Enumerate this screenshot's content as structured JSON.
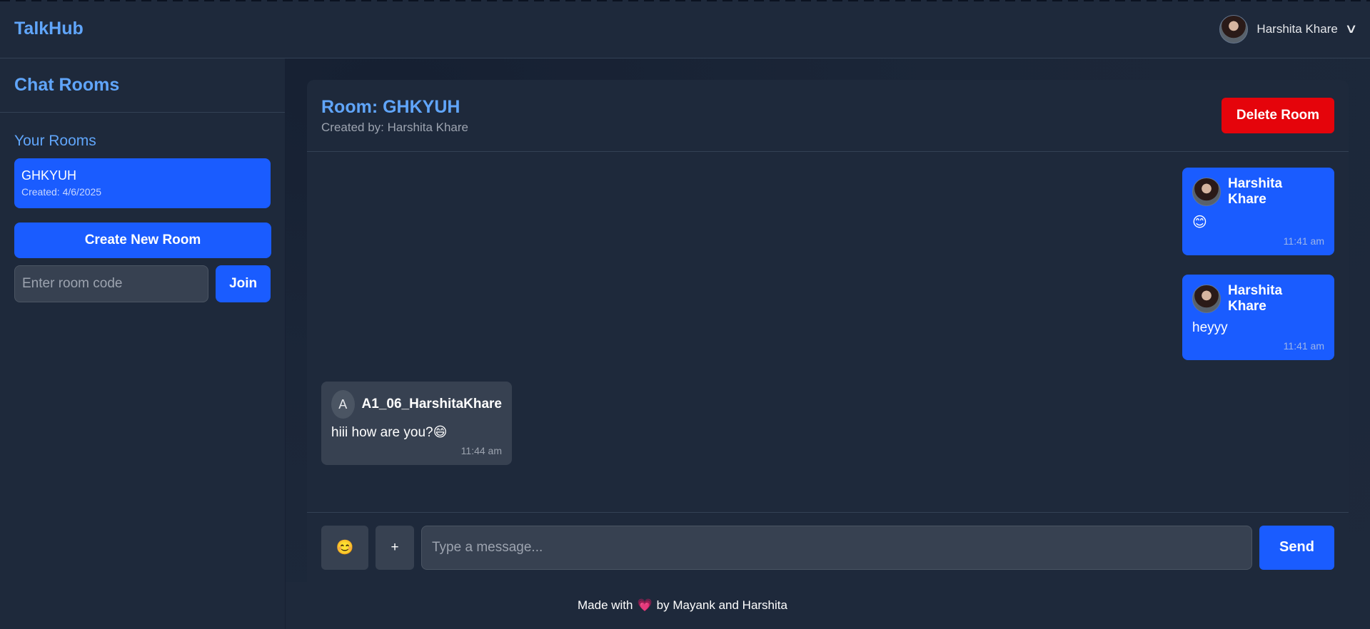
{
  "app": {
    "brand": "TalkHub"
  },
  "user": {
    "name": "Harshita Khare",
    "menu_icon": "chevron-down"
  },
  "sidebar": {
    "title": "Chat Rooms",
    "section_label": "Your Rooms",
    "rooms": [
      {
        "name": "GHKYUH",
        "created": "Created: 4/6/2025"
      }
    ],
    "create_button": "Create New Room",
    "room_code_placeholder": "Enter room code",
    "join_button": "Join"
  },
  "chat": {
    "room_title": "Room: GHKYUH",
    "created_by": "Created by: Harshita Khare",
    "delete_button": "Delete Room",
    "messages": [
      {
        "sender": "Harshita Khare",
        "text": "😊",
        "time": "11:41 am",
        "own": true
      },
      {
        "sender": "Harshita Khare",
        "text": "heyyy",
        "time": "11:41 am",
        "own": true
      },
      {
        "sender": "A1_06_HarshitaKhare",
        "avatar_initial": "A",
        "text": "hiii how are you?😄",
        "time": "11:44 am",
        "own": false
      }
    ],
    "composer": {
      "emoji_button": "😊",
      "attach_button": "+",
      "placeholder": "Type a message...",
      "send_button": "Send"
    }
  },
  "footer": {
    "prefix": "Made with",
    "heart": "💗",
    "suffix": "by Mayank and Harshita"
  },
  "colors": {
    "accent": "#1a5cff",
    "brand": "#60a5fa",
    "danger": "#e5040b",
    "background": "#1e293b"
  }
}
